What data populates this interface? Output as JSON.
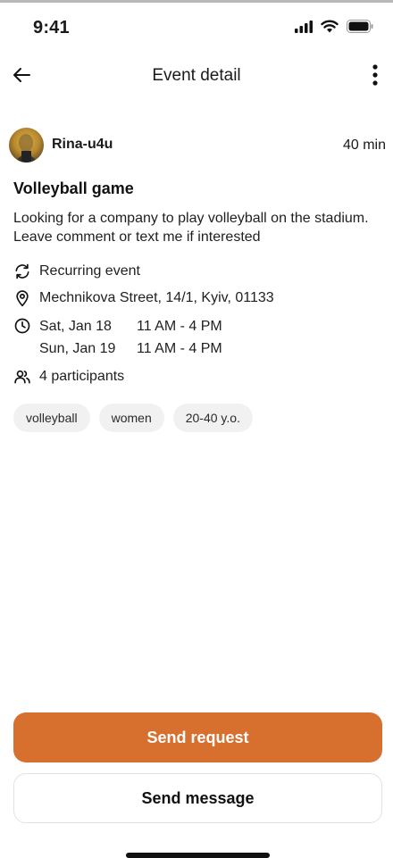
{
  "status_bar": {
    "time": "9:41"
  },
  "nav": {
    "title": "Event detail"
  },
  "author": {
    "name": "Rina-u4u",
    "time_ago": "40 min"
  },
  "event": {
    "title": "Volleyball game",
    "description": "Looking for a company to play volleyball on the stadium. Leave comment or text me if interested",
    "recurring": "Recurring event",
    "address": "Mechnikova Street, 14/1, Kyiv, 01133",
    "schedule": [
      {
        "date": "Sat, Jan 18",
        "time": "11 AM - 4 PM"
      },
      {
        "date": "Sun, Jan 19",
        "time": "11 AM - 4 PM"
      }
    ],
    "participants": "4 participants",
    "tags": [
      "volleyball",
      "women",
      "20-40 y.o."
    ]
  },
  "actions": {
    "primary": "Send request",
    "secondary": "Send message"
  },
  "colors": {
    "accent": "#d7702f",
    "tag_bg": "#f1f1f1"
  },
  "icons": {
    "back": "arrow-left-icon",
    "more": "more-vertical-icon",
    "recurring": "repeat-icon",
    "address": "location-pin-icon",
    "schedule": "clock-icon",
    "participants": "users-icon"
  }
}
